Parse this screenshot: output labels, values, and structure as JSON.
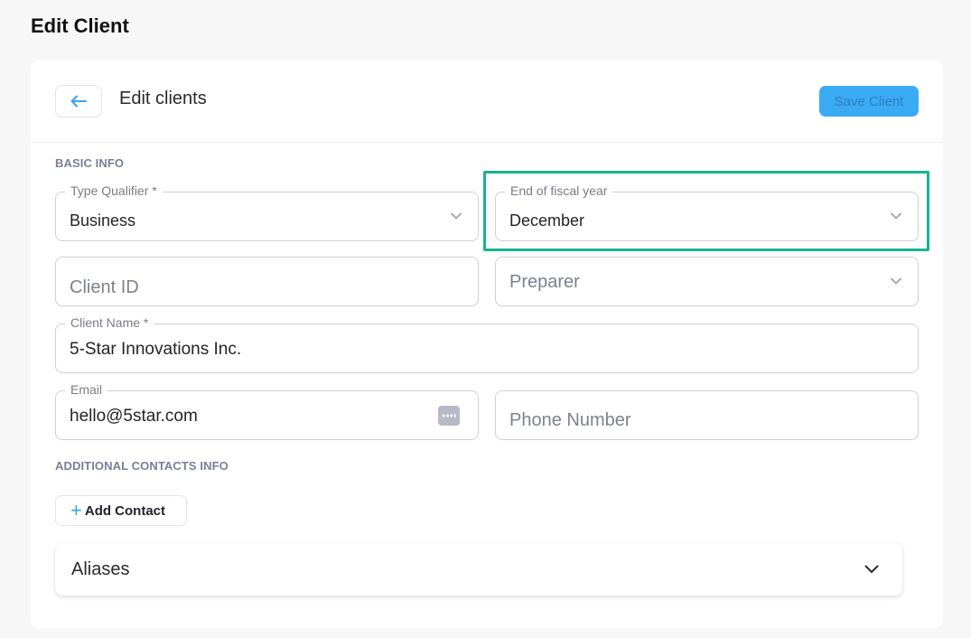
{
  "page": {
    "title": "Edit Client"
  },
  "header": {
    "title": "Edit clients",
    "save_label": "Save Client",
    "back_icon": "arrow-left-icon"
  },
  "sections": {
    "basic_info": "BASIC INFO",
    "additional_contacts": "ADDITIONAL CONTACTS INFO"
  },
  "fields": {
    "type_qualifier": {
      "label": "Type Qualifier *",
      "value": "Business"
    },
    "fiscal_year_end": {
      "label": "End of fiscal year",
      "value": "December"
    },
    "client_id": {
      "placeholder": "Client ID"
    },
    "preparer": {
      "placeholder": "Preparer"
    },
    "client_name": {
      "label": "Client Name *",
      "value": "5-Star Innovations Inc."
    },
    "email": {
      "label": "Email",
      "value": "hello@5star.com"
    },
    "phone": {
      "placeholder": "Phone Number"
    }
  },
  "contacts": {
    "add_label": "Add Contact"
  },
  "aliases": {
    "label": "Aliases"
  },
  "colors": {
    "accent": "#3baaf5",
    "highlight": "#14b591"
  }
}
